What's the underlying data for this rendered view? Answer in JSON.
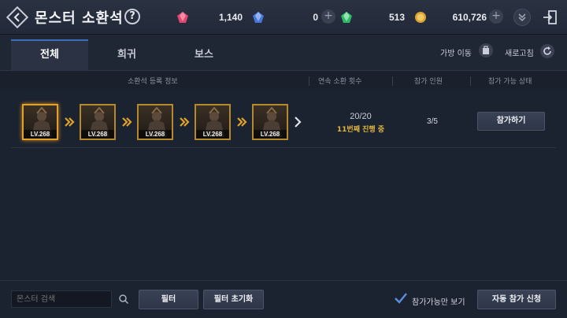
{
  "header": {
    "title": "몬스터 소환석",
    "help_label": "?",
    "currencies": [
      {
        "icon": "red-gem-icon",
        "value": "1,140"
      },
      {
        "icon": "blue-gem-icon",
        "value": "0"
      },
      {
        "icon": "green-gem-icon",
        "value": "513"
      },
      {
        "icon": "gold-coin-icon",
        "value": "610,726"
      }
    ],
    "plus_label": "+"
  },
  "tabs": [
    {
      "label": "전체",
      "active": true
    },
    {
      "label": "희귀",
      "active": false
    },
    {
      "label": "보스",
      "active": false
    }
  ],
  "actions": {
    "bag_move": "가방 이동",
    "refresh": "새로고침"
  },
  "table": {
    "headers": [
      "소환석 등록 정보",
      "연속 소환 횟수",
      "참가 인원",
      "참가 가능 상태"
    ],
    "rows": [
      {
        "monsters": [
          {
            "level": "LV.268",
            "selected": true
          },
          {
            "level": "LV.268",
            "selected": false
          },
          {
            "level": "LV.268",
            "selected": false
          },
          {
            "level": "LV.268",
            "selected": false
          },
          {
            "level": "LV.268",
            "selected": false
          }
        ],
        "summon_count": "20/20",
        "summon_status": "11번째 진행 중",
        "participants": "3/5",
        "join_label": "참가하기"
      }
    ]
  },
  "footer": {
    "search_placeholder": "몬스터 검색",
    "filter_label": "필터",
    "filter_reset_label": "필터 초기화",
    "joinable_only_label": "참가가능만 보기",
    "joinable_only_checked": true,
    "auto_join_label": "자동 참가 신청"
  },
  "colors": {
    "accent_blue": "#3d6fb8",
    "highlight_gold": "#e1b53f"
  }
}
